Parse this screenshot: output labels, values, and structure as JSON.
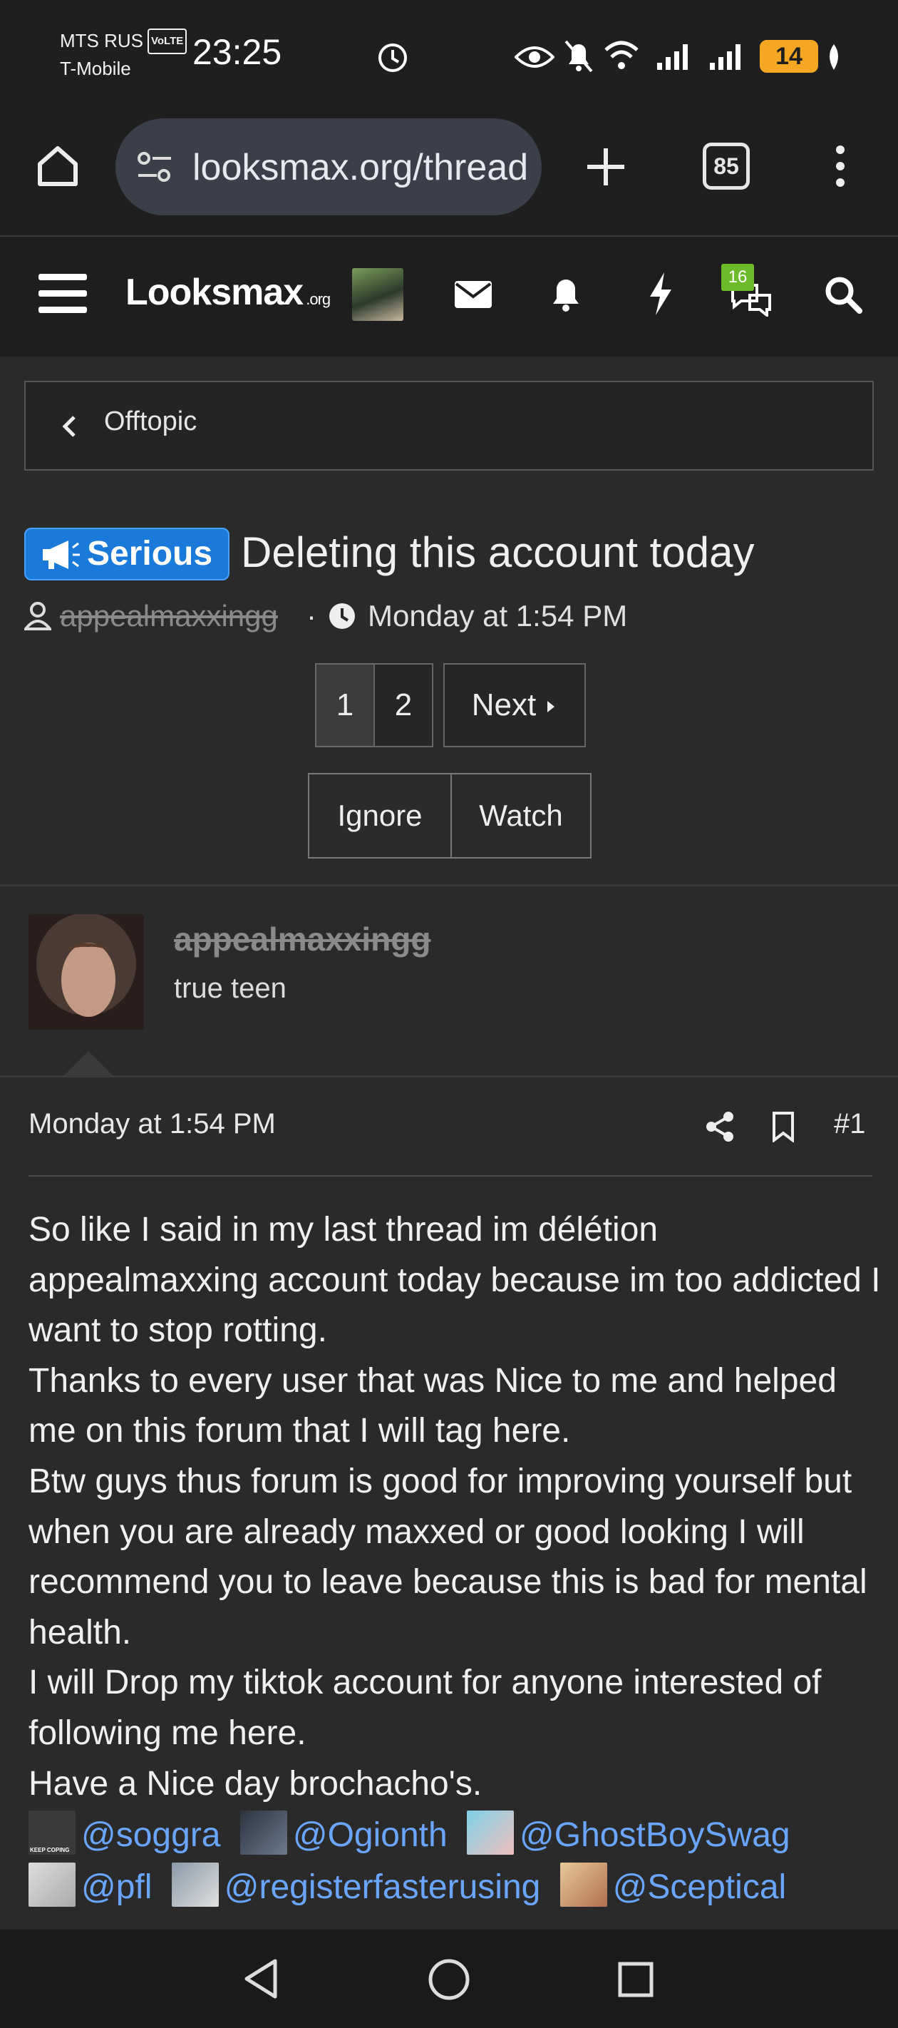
{
  "status_bar": {
    "carrier_1": "MTS RUS",
    "volte": "VoLTE",
    "carrier_2": "T-Mobile",
    "time": "23:25",
    "battery": "14"
  },
  "browser": {
    "url": "looksmax.org/threads/deleting-this-account-today",
    "tab_count": "85"
  },
  "site": {
    "logo": "Looksmax",
    "logo_suffix": ".org",
    "chat_badge": "16"
  },
  "breadcrumb": {
    "label": "Offtopic"
  },
  "thread": {
    "prefix": "Serious",
    "title": "Deleting this account today",
    "author": "appealmaxxingg",
    "date": "Monday at 1:54 PM",
    "separator": "·"
  },
  "pagination": {
    "pages": [
      "1",
      "2"
    ],
    "next_label": "Next"
  },
  "actions": {
    "ignore": "Ignore",
    "watch": "Watch"
  },
  "post": {
    "username": "appealmaxxingg",
    "user_title": "true teen",
    "date": "Monday at 1:54 PM",
    "number": "#1",
    "lines": [
      "So like I said in my last thread im délétion appealmaxxing account today because im too addicted I want to stop rotting.",
      "Thanks to every user that was Nice to me and helped me on this forum that I will tag here.",
      "Btw guys thus forum is good for improving yourself but when you are already maxxed or good looking I will recommend you to leave because this is bad for mental health.",
      "I will Drop my tiktok account for anyone interested of following me here.",
      "Have a Nice day brochacho's."
    ],
    "tags_row_1": [
      "@soggra",
      "@Ogionth",
      "@GhostBoySwag"
    ],
    "tags_row_2": [
      "@pfl",
      "@registerfasterusing",
      "@Sceptical"
    ],
    "thumb_caption": "KEEP COPING"
  },
  "colors": {
    "accent": "#1a7ad9",
    "link": "#6aa6ff",
    "badge": "#6dbb2a",
    "battery": "#f5a623"
  }
}
